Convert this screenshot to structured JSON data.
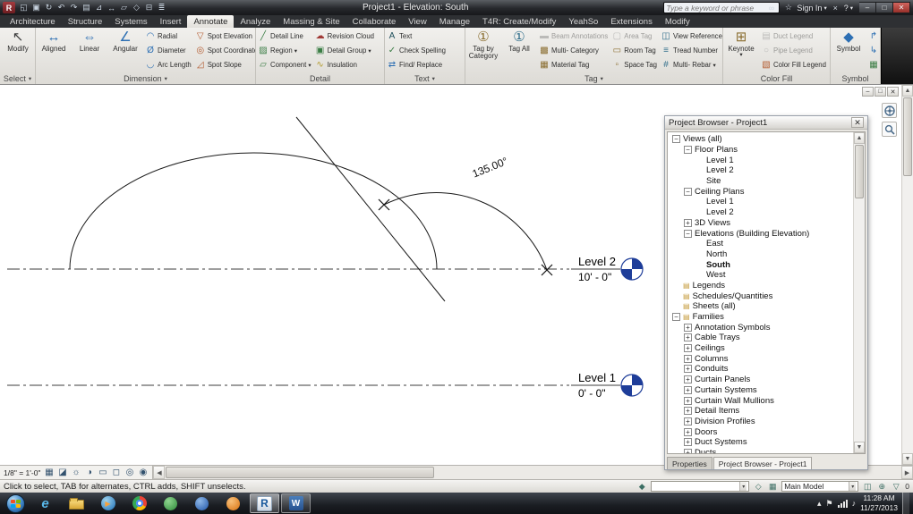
{
  "titlebar": {
    "title": "Project1 - Elevation: South",
    "search": {
      "placeholder": "Type a keyword or phrase"
    },
    "sign_in_label": "Sign In",
    "quick_access_icons": [
      "open-icon",
      "save-icon",
      "sync-icon",
      "undo-icon",
      "redo-icon",
      "print-icon",
      "measure-icon",
      "dimension-icon",
      "tag-icon",
      "view-3d-icon",
      "section-icon",
      "thin-lines-icon"
    ]
  },
  "ribbon": {
    "active_tab": "Annotate",
    "tabs": [
      "Architecture",
      "Structure",
      "Systems",
      "Insert",
      "Annotate",
      "Analyze",
      "Massing & Site",
      "Collaborate",
      "View",
      "Manage",
      "T4R: Create/Modify",
      "YeahSo",
      "Extensions",
      "Modify"
    ],
    "panels": [
      {
        "label": "Select",
        "dropdown": true,
        "groups": [
          {
            "type": "large",
            "buttons": [
              {
                "label": "Modify",
                "icon": "modify-cursor-icon"
              }
            ]
          }
        ]
      },
      {
        "label": "Dimension",
        "dropdown": true,
        "groups": [
          {
            "type": "large",
            "buttons": [
              {
                "label": "Aligned",
                "icon": "aligned-dimension-icon"
              },
              {
                "label": "Linear",
                "icon": "linear-dimension-icon"
              },
              {
                "label": "Angular",
                "icon": "angular-dimension-icon"
              }
            ]
          },
          {
            "type": "stack",
            "buttons": [
              {
                "label": "Radial",
                "icon": "radial-dimension-icon"
              },
              {
                "label": "Diameter",
                "icon": "diameter-dimension-icon"
              },
              {
                "label": "Arc Length",
                "icon": "arc-length-icon"
              }
            ]
          },
          {
            "type": "stack",
            "buttons": [
              {
                "label": "Spot Elevation",
                "icon": "spot-elevation-icon"
              },
              {
                "label": "Spot Coordinate",
                "icon": "spot-coordinate-icon"
              },
              {
                "label": "Spot Slope",
                "icon": "spot-slope-icon"
              }
            ]
          }
        ]
      },
      {
        "label": "Detail",
        "dropdown": false,
        "groups": [
          {
            "type": "stack",
            "buttons": [
              {
                "label": "Detail Line",
                "icon": "detail-line-icon"
              },
              {
                "label": "Region",
                "icon": "region-icon",
                "dropdown": true
              },
              {
                "label": "Component",
                "icon": "component-icon",
                "dropdown": true
              }
            ]
          },
          {
            "type": "stack",
            "buttons": [
              {
                "label": "Revision Cloud",
                "icon": "revision-cloud-icon"
              },
              {
                "label": "Detail Group",
                "icon": "detail-group-icon",
                "dropdown": true
              },
              {
                "label": "Insulation",
                "icon": "insulation-icon"
              }
            ]
          }
        ]
      },
      {
        "label": "Text",
        "dropdown": true,
        "groups": [
          {
            "type": "stack",
            "buttons": [
              {
                "label": "Text",
                "icon": "text-icon"
              },
              {
                "label": "Check Spelling",
                "icon": "check-spelling-icon"
              },
              {
                "label": "Find/ Replace",
                "icon": "find-replace-icon"
              }
            ]
          }
        ]
      },
      {
        "label": "Tag",
        "dropdown": true,
        "groups": [
          {
            "type": "large",
            "buttons": [
              {
                "label": "Tag by Category",
                "icon": "tag-by-category-icon"
              },
              {
                "label": "Tag All",
                "icon": "tag-all-icon"
              }
            ]
          },
          {
            "type": "stack",
            "buttons": [
              {
                "label": "Beam Annotations",
                "icon": "beam-annotations-icon",
                "disabled": true
              },
              {
                "label": "Multi- Category",
                "icon": "multi-category-icon"
              },
              {
                "label": "Material Tag",
                "icon": "material-tag-icon"
              }
            ]
          },
          {
            "type": "stack",
            "buttons": [
              {
                "label": "Area Tag",
                "icon": "area-tag-icon",
                "disabled": true
              },
              {
                "label": "Room Tag",
                "icon": "room-tag-icon"
              },
              {
                "label": "Space Tag",
                "icon": "space-tag-icon"
              }
            ]
          },
          {
            "type": "stack",
            "buttons": [
              {
                "label": "View Reference",
                "icon": "view-reference-icon"
              },
              {
                "label": "Tread Number",
                "icon": "tread-number-icon"
              },
              {
                "label": "Multi- Rebar",
                "icon": "multi-rebar-icon",
                "dropdown": true
              }
            ]
          }
        ]
      },
      {
        "label": "Color Fill",
        "dropdown": false,
        "groups": [
          {
            "type": "large",
            "buttons": [
              {
                "label": "Keynote",
                "icon": "keynote-icon",
                "dropdown": true
              }
            ]
          },
          {
            "type": "stack",
            "buttons": [
              {
                "label": "Duct Legend",
                "icon": "duct-legend-icon",
                "disabled": true
              },
              {
                "label": "Pipe Legend",
                "icon": "pipe-legend-icon",
                "disabled": true
              },
              {
                "label": "Color Fill Legend",
                "icon": "color-fill-legend-icon"
              }
            ]
          }
        ]
      },
      {
        "label": "Symbol",
        "dropdown": false,
        "groups": [
          {
            "type": "large",
            "buttons": [
              {
                "label": "Symbol",
                "icon": "symbol-icon"
              }
            ]
          },
          {
            "type": "stack",
            "buttons": [
              {
                "label": "",
                "icon": "stair-arrow-up-icon"
              },
              {
                "label": "",
                "icon": "stair-arrow-down-icon"
              },
              {
                "label": "",
                "icon": "area-boundary-icon"
              }
            ]
          }
        ]
      }
    ]
  },
  "drawing": {
    "angle_label": "135.00°",
    "levels": [
      {
        "name": "Level 2",
        "elevation": "10' - 0\""
      },
      {
        "name": "Level 1",
        "elevation": "0' - 0\""
      }
    ],
    "datum_color": "#1e3d99"
  },
  "project_browser": {
    "title": "Project Browser - Project1",
    "tabs": [
      "Properties",
      "Project Browser - Project1"
    ],
    "active_tab": "Project Browser - Project1",
    "tree": [
      {
        "label": "Views (all)",
        "indent": 0,
        "expander": "minus"
      },
      {
        "label": "Floor Plans",
        "indent": 1,
        "expander": "minus"
      },
      {
        "label": "Level 1",
        "indent": 2,
        "expander": "none"
      },
      {
        "label": "Level 2",
        "indent": 2,
        "expander": "none"
      },
      {
        "label": "Site",
        "indent": 2,
        "expander": "none"
      },
      {
        "label": "Ceiling Plans",
        "indent": 1,
        "expander": "minus"
      },
      {
        "label": "Level 1",
        "indent": 2,
        "expander": "none"
      },
      {
        "label": "Level 2",
        "indent": 2,
        "expander": "none"
      },
      {
        "label": "3D Views",
        "indent": 1,
        "expander": "plus"
      },
      {
        "label": "Elevations (Building Elevation)",
        "indent": 1,
        "expander": "minus"
      },
      {
        "label": "East",
        "indent": 2,
        "expander": "none"
      },
      {
        "label": "North",
        "indent": 2,
        "expander": "none"
      },
      {
        "label": "South",
        "indent": 2,
        "expander": "none",
        "bold": true
      },
      {
        "label": "West",
        "indent": 2,
        "expander": "none"
      },
      {
        "label": "Legends",
        "indent": 0,
        "expander": "none",
        "icon": true
      },
      {
        "label": "Schedules/Quantities",
        "indent": 0,
        "expander": "none",
        "icon": true
      },
      {
        "label": "Sheets (all)",
        "indent": 0,
        "expander": "none",
        "icon": true
      },
      {
        "label": "Families",
        "indent": 0,
        "expander": "minus",
        "icon": true
      },
      {
        "label": "Annotation Symbols",
        "indent": 1,
        "expander": "plus"
      },
      {
        "label": "Cable Trays",
        "indent": 1,
        "expander": "plus"
      },
      {
        "label": "Ceilings",
        "indent": 1,
        "expander": "plus"
      },
      {
        "label": "Columns",
        "indent": 1,
        "expander": "plus"
      },
      {
        "label": "Conduits",
        "indent": 1,
        "expander": "plus"
      },
      {
        "label": "Curtain Panels",
        "indent": 1,
        "expander": "plus"
      },
      {
        "label": "Curtain Systems",
        "indent": 1,
        "expander": "plus"
      },
      {
        "label": "Curtain Wall Mullions",
        "indent": 1,
        "expander": "plus"
      },
      {
        "label": "Detail Items",
        "indent": 1,
        "expander": "plus"
      },
      {
        "label": "Division Profiles",
        "indent": 1,
        "expander": "plus"
      },
      {
        "label": "Doors",
        "indent": 1,
        "expander": "plus"
      },
      {
        "label": "Duct Systems",
        "indent": 1,
        "expander": "plus"
      },
      {
        "label": "Ducts",
        "indent": 1,
        "expander": "plus"
      }
    ]
  },
  "view_control_bar": {
    "scale": "1/8\" = 1'-0\"",
    "icons": [
      "detail-level-icon",
      "visual-style-icon",
      "sun-path-icon",
      "shadows-icon",
      "crop-view-icon",
      "show-crop-region-icon",
      "temporary-hide-isolate-icon",
      "reveal-hidden-elements-icon"
    ]
  },
  "status_bar": {
    "message": "Click to select, TAB for alternates, CTRL adds, SHIFT unselects.",
    "workset_value": "",
    "design_option_value": "Main Model",
    "filter_count": "0"
  },
  "taskbar": {
    "apps": [
      {
        "icon": "internet-explorer-icon",
        "open": false,
        "active": false
      },
      {
        "icon": "file-explorer-icon",
        "open": false,
        "active": false
      },
      {
        "icon": "media-player-icon",
        "open": false,
        "active": false
      },
      {
        "icon": "chrome-icon",
        "open": false,
        "active": false
      },
      {
        "icon": "green-app-icon",
        "open": false,
        "active": false
      },
      {
        "icon": "blue-app-icon",
        "open": false,
        "active": false
      },
      {
        "icon": "orange-app-icon",
        "open": false,
        "active": false
      },
      {
        "icon": "revit-icon",
        "open": true,
        "active": true
      },
      {
        "icon": "word-icon",
        "open": true,
        "active": false
      }
    ],
    "clock": {
      "time": "11:28 AM",
      "date": "11/27/2013"
    }
  }
}
